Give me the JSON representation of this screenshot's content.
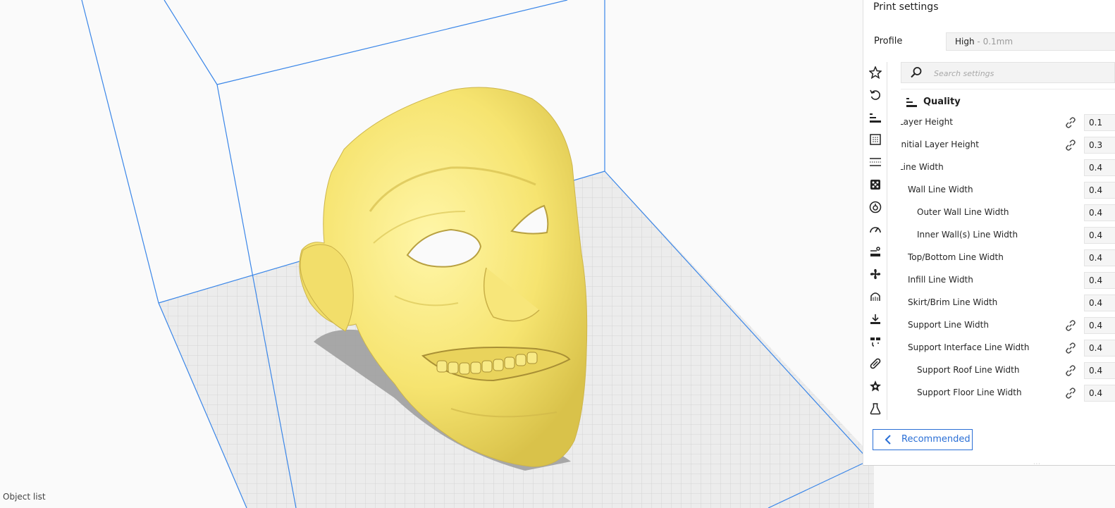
{
  "viewport": {
    "object_list_label": "Object list",
    "model_color": "#fbef86"
  },
  "print_settings": {
    "title": "Print settings",
    "profile": {
      "label": "Profile",
      "value": "High",
      "detail": "- 0.1mm"
    },
    "search": {
      "placeholder": "Search settings"
    },
    "category_icons": [
      "star-icon",
      "undo-icon",
      "quality-icon",
      "walls-icon",
      "top-bottom-icon",
      "infill-icon",
      "material-icon",
      "speed-icon",
      "travel-icon",
      "cooling-icon",
      "support-icon",
      "adhesion-icon",
      "dual-extrusion-icon",
      "mesh-fixes-icon",
      "special-modes-icon",
      "experimental-icon"
    ],
    "category": {
      "label": "Quality",
      "icon": "quality-icon"
    },
    "settings": [
      {
        "label": "Layer Height",
        "value": "0.1",
        "linked": true,
        "indent": 0
      },
      {
        "label": "Initial Layer Height",
        "value": "0.3",
        "linked": true,
        "indent": 0
      },
      {
        "label": "Line Width",
        "value": "0.4",
        "linked": false,
        "indent": 0
      },
      {
        "label": "Wall Line Width",
        "value": "0.4",
        "linked": false,
        "indent": 1
      },
      {
        "label": "Outer Wall Line Width",
        "value": "0.4",
        "linked": false,
        "indent": 2
      },
      {
        "label": "Inner Wall(s) Line Width",
        "value": "0.4",
        "linked": false,
        "indent": 2
      },
      {
        "label": "Top/Bottom Line Width",
        "value": "0.4",
        "linked": false,
        "indent": 1
      },
      {
        "label": "Infill Line Width",
        "value": "0.4",
        "linked": false,
        "indent": 1
      },
      {
        "label": "Skirt/Brim Line Width",
        "value": "0.4",
        "linked": false,
        "indent": 1
      },
      {
        "label": "Support Line Width",
        "value": "0.4",
        "linked": true,
        "indent": 1
      },
      {
        "label": "Support Interface Line Width",
        "value": "0.4",
        "linked": true,
        "indent": 1
      },
      {
        "label": "Support Roof Line Width",
        "value": "0.4",
        "linked": true,
        "indent": 2
      },
      {
        "label": "Support Floor Line Width",
        "value": "0.4",
        "linked": true,
        "indent": 2
      }
    ],
    "recommended_button": {
      "label": "Recommended"
    },
    "accent_color": "#2a6fd6"
  }
}
